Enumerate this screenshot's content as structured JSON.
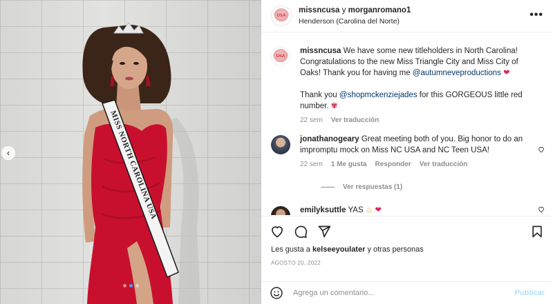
{
  "post": {
    "header": {
      "user1": "missncusa",
      "connector": "y",
      "user2": "morganromano1",
      "location": "Henderson (Carolina del Norte)",
      "more_icon": "more-horizontal-icon"
    },
    "caption": {
      "username": "missncusa",
      "text_part1": "We have some new titleholders in North Carolina! Congratulations to the new Miss Triangle City and Miss City of Oaks! Thank you for having me",
      "mention1": "@autumneveproductions",
      "text_part2": "Thank you",
      "mention2": "@shopmckenziejades",
      "text_part3": "for this GORGEOUS little red number.",
      "time": "22 sem",
      "translate": "Ver traducción"
    },
    "comments": [
      {
        "username": "jonathanogeary",
        "text": "Great meeting both of you. Big honor to do an impromptu mock on Miss NC USA and NC Teen USA!",
        "time": "22 sem",
        "likes": "1 Me gusta",
        "reply": "Responder",
        "translate": "Ver traducción",
        "view_replies": "Ver respuestas (1)"
      },
      {
        "username": "emilyksuttle",
        "text": "YAS"
      }
    ],
    "actions": {
      "like_icon": "heart-icon",
      "comment_icon": "comment-icon",
      "share_icon": "paper-plane-icon",
      "save_icon": "bookmark-icon"
    },
    "likes_prefix": "Les gusta a",
    "likes_user": "kelseeyoulater",
    "likes_suffix": "y otras personas",
    "date": "AGOSTO 20, 2022",
    "add_comment": {
      "placeholder": "Agrega un comentario...",
      "publish": "Publicar"
    },
    "carousel": {
      "slides": 3,
      "active": 2
    }
  },
  "colors": {
    "mention": "#00376b",
    "muted": "#8e8e8e",
    "heart_red": "#ed4956",
    "publish_disabled": "#b2dffc",
    "dress_red": "#c8102e"
  }
}
